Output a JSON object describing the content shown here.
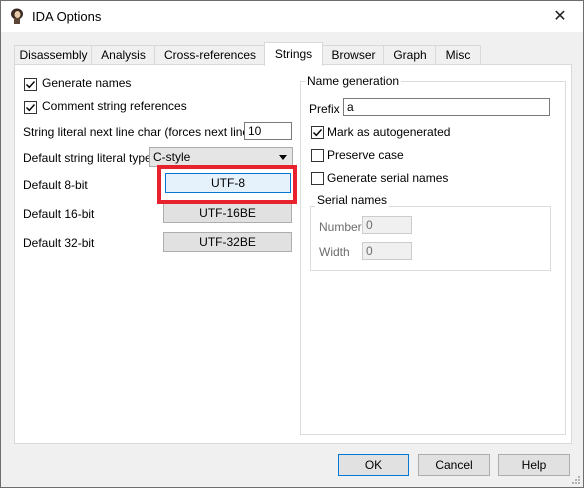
{
  "window": {
    "title": "IDA Options",
    "close_glyph": "✕"
  },
  "tabs": [
    {
      "label": "Disassembly"
    },
    {
      "label": "Analysis"
    },
    {
      "label": "Cross-references"
    },
    {
      "label": "Strings"
    },
    {
      "label": "Browser"
    },
    {
      "label": "Graph"
    },
    {
      "label": "Misc"
    }
  ],
  "left": {
    "generate_names": {
      "label": "Generate names",
      "checked": true
    },
    "comment_refs": {
      "label": "Comment string references",
      "checked": true
    },
    "next_line_char": {
      "label": "String literal next line char (forces next line)",
      "value": "10"
    },
    "default_type": {
      "label": "Default string literal type",
      "value": "C-style"
    },
    "enc8": {
      "label": "Default 8-bit",
      "button": "UTF-8"
    },
    "enc16": {
      "label": "Default 16-bit",
      "button": "UTF-16BE"
    },
    "enc32": {
      "label": "Default 32-bit",
      "button": "UTF-32BE"
    }
  },
  "name_generation": {
    "title": "Name generation",
    "prefix_label": "Prefix",
    "prefix_value": "a",
    "mark_autogen": {
      "label": "Mark as autogenerated",
      "checked": true
    },
    "preserve_case": {
      "label": "Preserve case",
      "checked": false
    },
    "gen_serial": {
      "label": "Generate serial names",
      "checked": false
    },
    "serial_names": {
      "title": "Serial names",
      "number_label": "Number",
      "number_value": "0",
      "width_label": "Width",
      "width_value": "0"
    }
  },
  "footer": {
    "ok": "OK",
    "cancel": "Cancel",
    "help": "Help"
  },
  "colors": {
    "highlight": "#e8222c",
    "focus": "#0078d7"
  }
}
